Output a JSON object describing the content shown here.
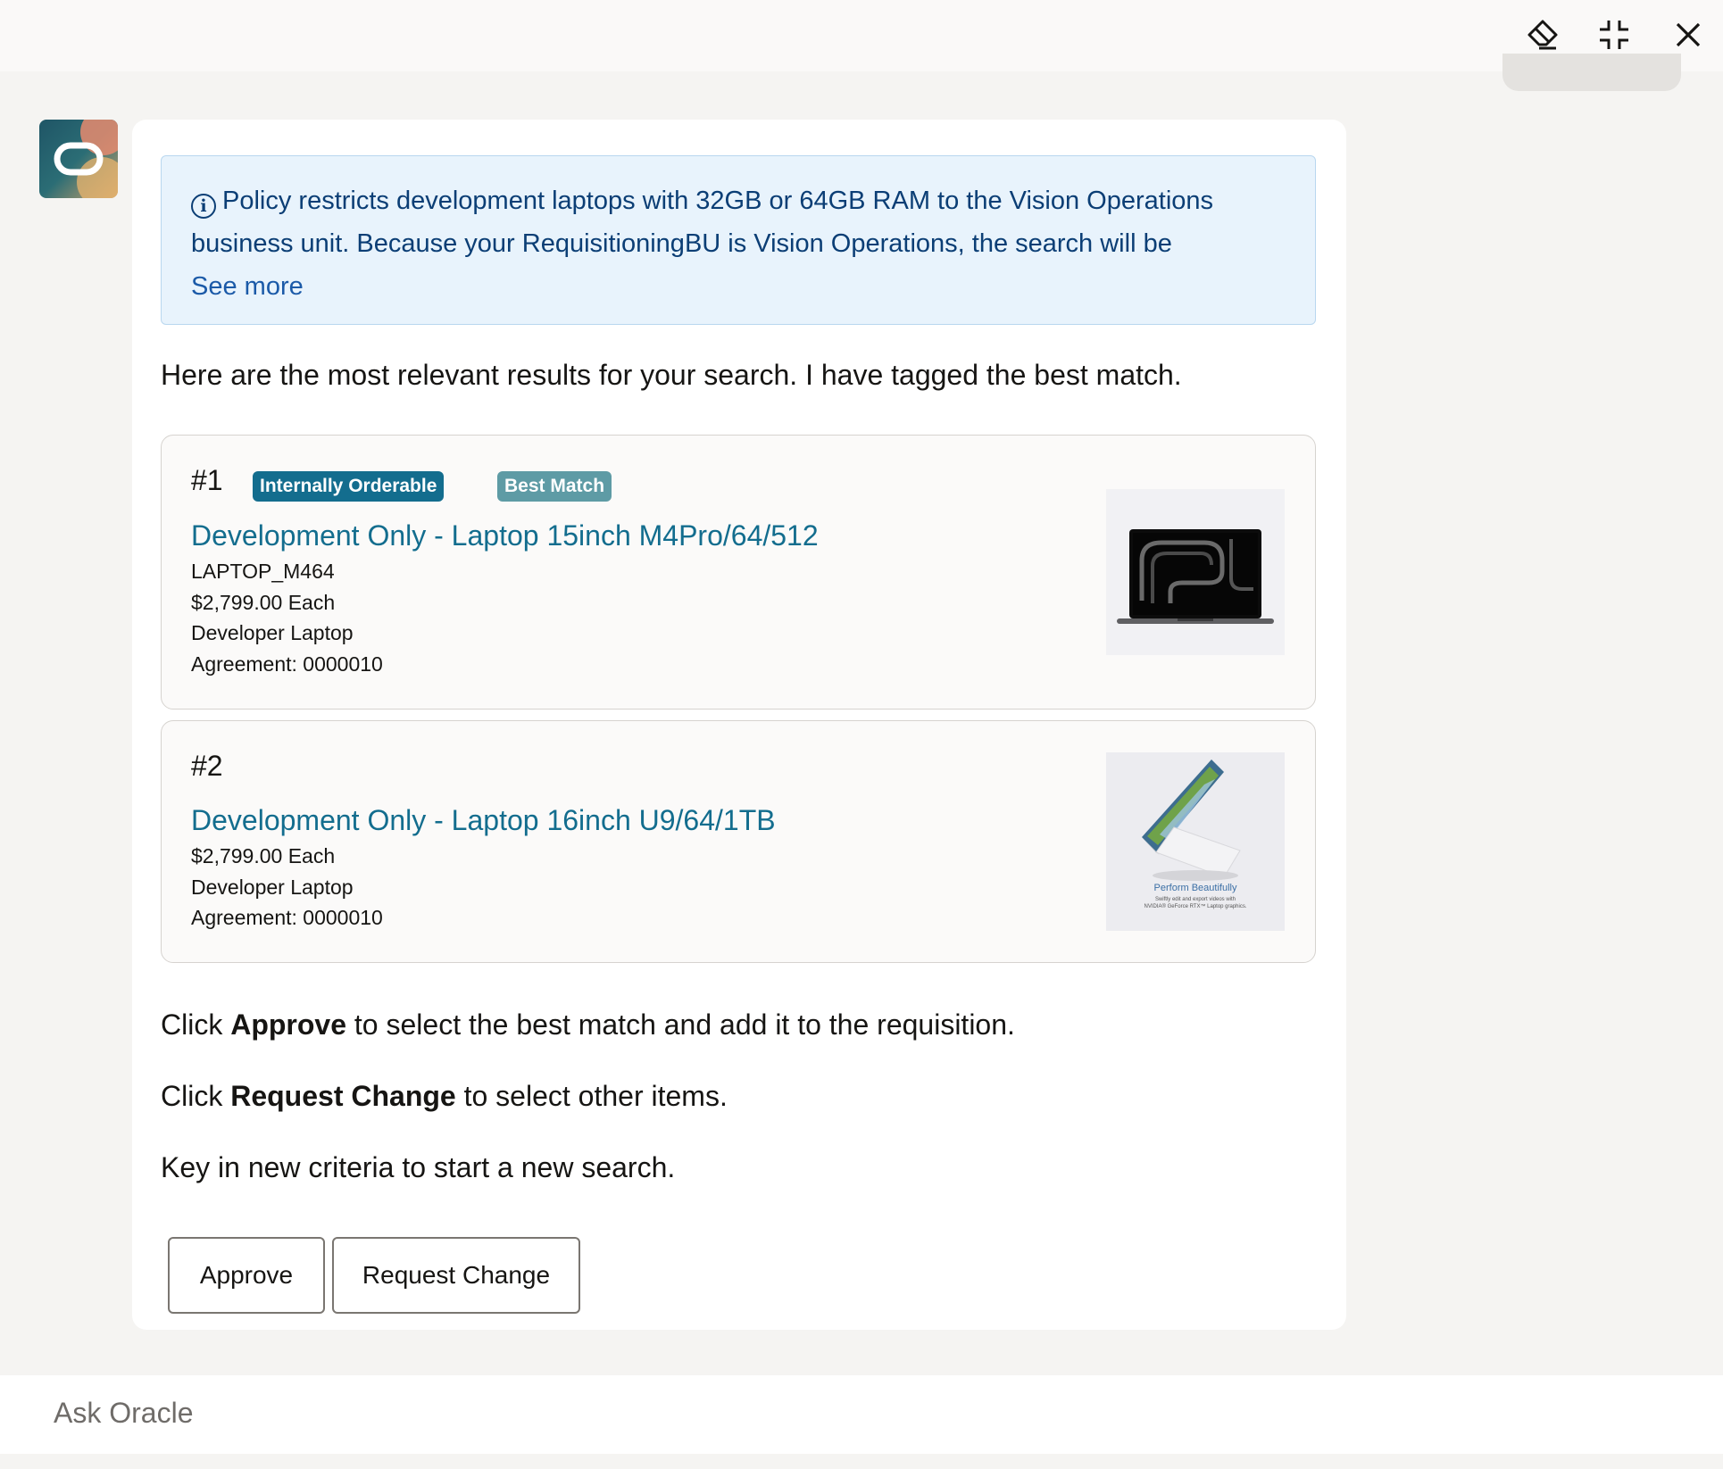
{
  "policy_notice": {
    "text": "Policy restricts development laptops with 32GB or 64GB RAM to the Vision Operations business unit. Because your RequisitioningBU is Vision Operations, the search will be",
    "see_more": "See more"
  },
  "intro": "Here are the most relevant results for your search. I have tagged the best match.",
  "results": [
    {
      "rank": "#1",
      "badges": [
        "Internally Orderable",
        "Best Match"
      ],
      "title": "Development Only - Laptop 15inch M4Pro/64/512",
      "item_number": "LAPTOP_M464",
      "price": "$2,799.00 Each",
      "category": "Developer Laptop",
      "agreement": "Agreement: 0000010"
    },
    {
      "rank": "#2",
      "title": "Development Only - Laptop 16inch U9/64/1TB",
      "price": "$2,799.00 Each",
      "category": "Developer Laptop",
      "agreement": "Agreement: 0000010",
      "image_caption": "Perform Beautifully",
      "image_subcaption_1": "Swiftly edit and export videos with",
      "image_subcaption_2": "NVIDIA® GeForce RTX™ Laptop graphics."
    }
  ],
  "instructions": {
    "approve_prefix": "Click ",
    "approve_bold": "Approve",
    "approve_suffix": " to select the best match and add it to the requisition.",
    "change_prefix": "Click ",
    "change_bold": "Request Change",
    "change_suffix": " to select other items.",
    "new_search": "Key in new criteria to start a new search."
  },
  "buttons": {
    "approve": "Approve",
    "request_change": "Request Change"
  },
  "input": {
    "placeholder": "Ask Oracle"
  },
  "icons": [
    "eraser-icon",
    "collapse-icon",
    "close-icon"
  ],
  "colors": {
    "link": "#136d8e",
    "badge_internal": "#136d8e",
    "badge_best": "#5e9ba5",
    "info_bg": "#e8f3fc",
    "info_text": "#0b3e75"
  }
}
